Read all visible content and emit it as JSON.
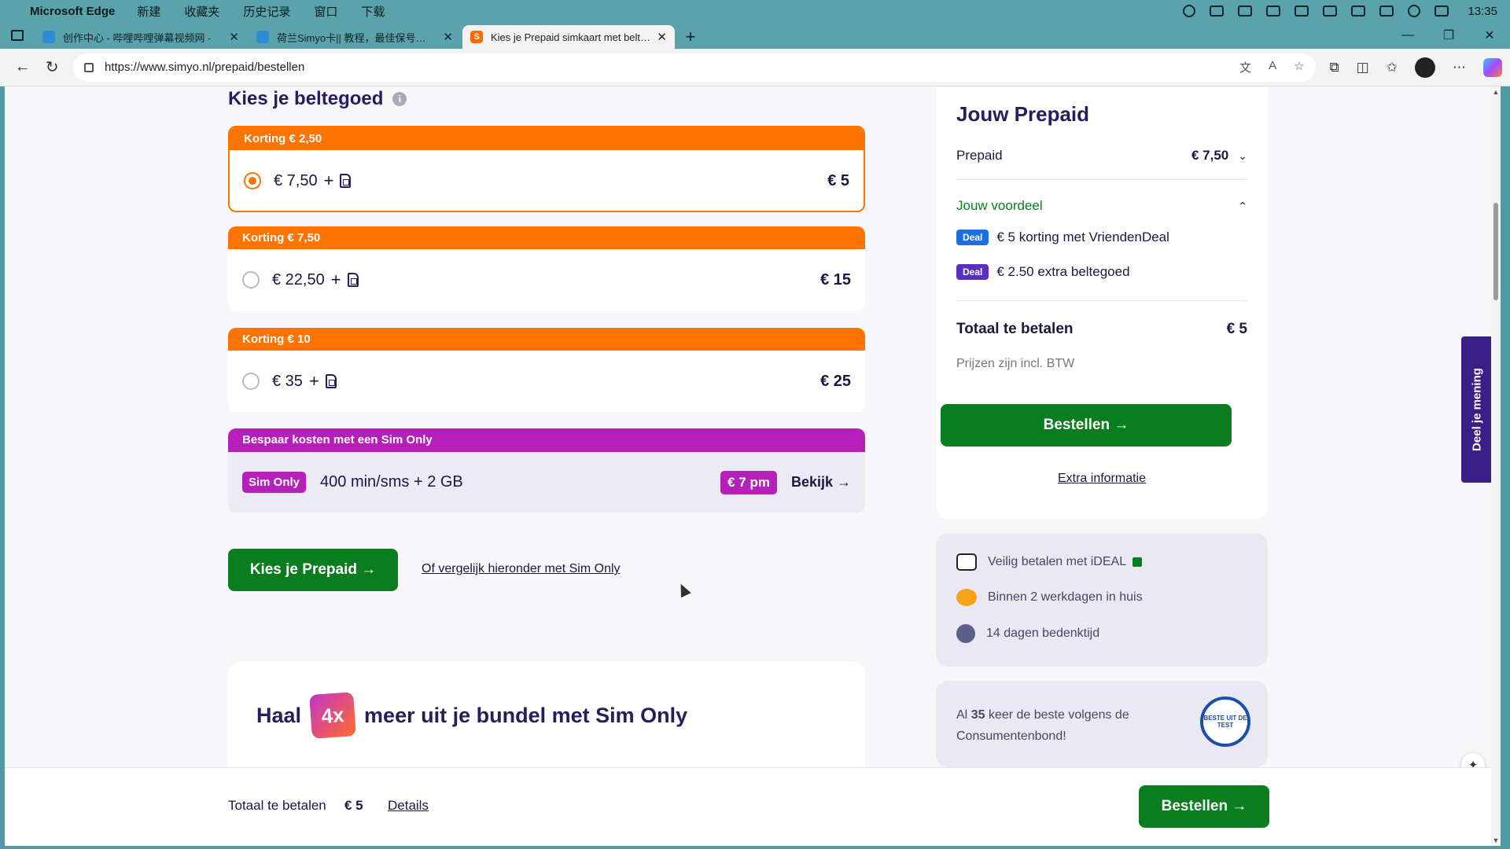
{
  "menubar": {
    "app_name": "Microsoft Edge",
    "items": [
      "新建",
      "收藏夹",
      "历史记录",
      "窗口",
      "下载"
    ],
    "clock": "13:35"
  },
  "tabs": [
    {
      "title": "创作中心 - 哔哩哔哩弹幕视频网 -",
      "active": false
    },
    {
      "title": "荷兰Simyo卡|| 教程，最佳保号…",
      "active": false
    },
    {
      "title": "Kies je Prepaid simkaart met belt…",
      "active": true
    }
  ],
  "address": {
    "url": "https://www.simyo.nl/prepaid/bestellen"
  },
  "page": {
    "section_title": "Kies je beltegoed",
    "options": [
      {
        "ribbon": "Korting € 2,50",
        "amount": "€ 7,50",
        "price": "€ 5",
        "selected": true
      },
      {
        "ribbon": "Korting € 7,50",
        "amount": "€ 22,50",
        "price": "€ 15",
        "selected": false
      },
      {
        "ribbon": "Korting € 10",
        "amount": "€ 35",
        "price": "€ 25",
        "selected": false
      }
    ],
    "simonly": {
      "ribbon": "Bespaar kosten met een Sim Only",
      "badge": "Sim Only",
      "desc": "400 min/sms + 2 GB",
      "price": "€ 7 pm",
      "link": "Bekijk →"
    },
    "kies_button": "Kies je Prepaid →",
    "compare_link": "Of vergelijk hieronder met Sim Only",
    "haal": {
      "pre": "Haal",
      "badge": "4x",
      "post": "meer uit je bundel met Sim Only"
    }
  },
  "summary": {
    "title": "Jouw Prepaid",
    "prepaid_label": "Prepaid",
    "prepaid_value": "€ 7,50",
    "voordeel_label": "Jouw voordeel",
    "deals": [
      {
        "tag": "Deal",
        "text": "€ 5 korting met VriendenDeal"
      },
      {
        "tag": "Deal",
        "text": "€ 2.50 extra beltegoed"
      }
    ],
    "total_label": "Totaal te betalen",
    "total_value": "€ 5",
    "btw": "Prijzen zijn incl. BTW",
    "order_button": "Bestellen →",
    "extra_info": "Extra informatie"
  },
  "trust": {
    "ideal": "Veilig betalen met iDEAL",
    "delivery": "Binnen 2 werkdagen in huis",
    "bedenktijd": "14 dagen bedenktijd"
  },
  "consumentenbond": {
    "prefix": "Al",
    "count": "35",
    "suffix": "keer de beste volgens de Consumentenbond!",
    "seal": "BESTE UIT DE TEST"
  },
  "feedback_tab": "Deel je mening",
  "footer": {
    "total_label": "Totaal te betalen",
    "total_value": "€ 5",
    "details": "Details",
    "order_button": "Bestellen →"
  },
  "colors": {
    "orange": "#ff7300",
    "green": "#0a7d1f",
    "purple": "#b520b8",
    "navy": "#2a1a5e"
  }
}
